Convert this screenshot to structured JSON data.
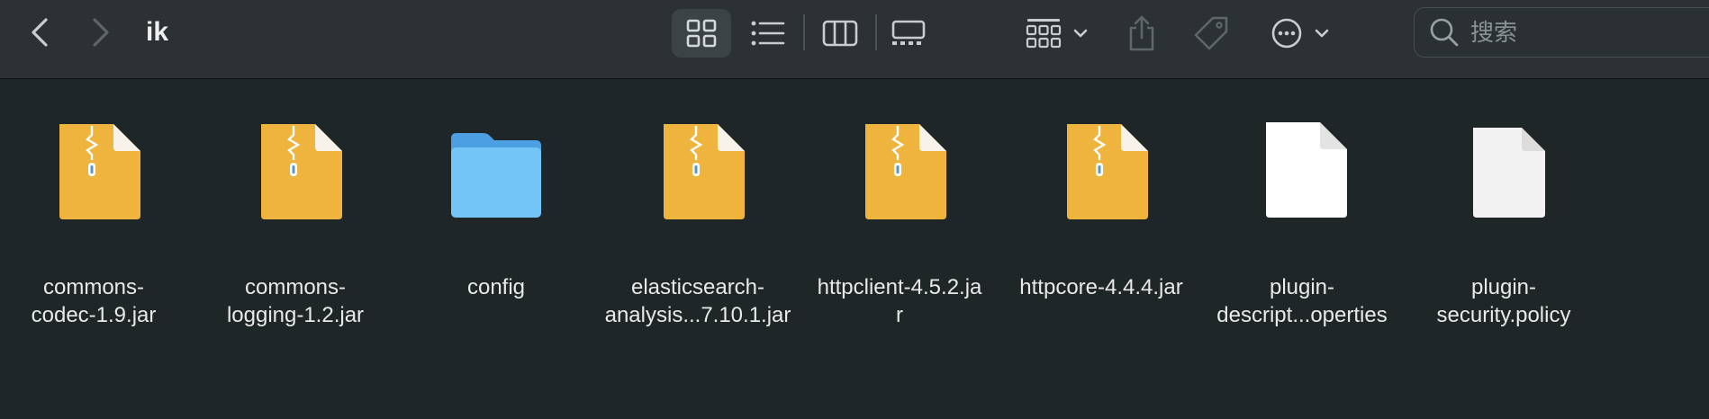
{
  "window": {
    "title": "ik"
  },
  "toolbar": {
    "back_icon": "chevron-left-icon",
    "forward_icon": "chevron-right-icon",
    "views": [
      "icon-view",
      "list-view",
      "column-view",
      "gallery-view"
    ],
    "selected_view": "icon-view",
    "group_icon": "group-icon",
    "share_icon": "share-icon",
    "tag_icon": "tag-icon",
    "more_icon": "ellipsis-circle-icon"
  },
  "search": {
    "placeholder": "搜索"
  },
  "colors": {
    "background": "#1f2628",
    "toolbar": "#2b3134",
    "archive": "#efb43e",
    "folder": "#6fc3f5"
  },
  "files": [
    {
      "name": "commons-\ncodec-1.9.jar",
      "type": "archive"
    },
    {
      "name": "commons-\nlogging-1.2.jar",
      "type": "archive"
    },
    {
      "name": "config",
      "type": "folder"
    },
    {
      "name": "elasticsearch-\nanalysis...7.10.1.jar",
      "type": "archive"
    },
    {
      "name": "httpclient-4.5.2.ja\nr",
      "type": "archive"
    },
    {
      "name": "httpcore-4.4.4.jar",
      "type": "archive"
    },
    {
      "name": "plugin-\ndescript...operties",
      "type": "document"
    },
    {
      "name": "plugin-\nsecurity.policy",
      "type": "document-gray"
    }
  ]
}
